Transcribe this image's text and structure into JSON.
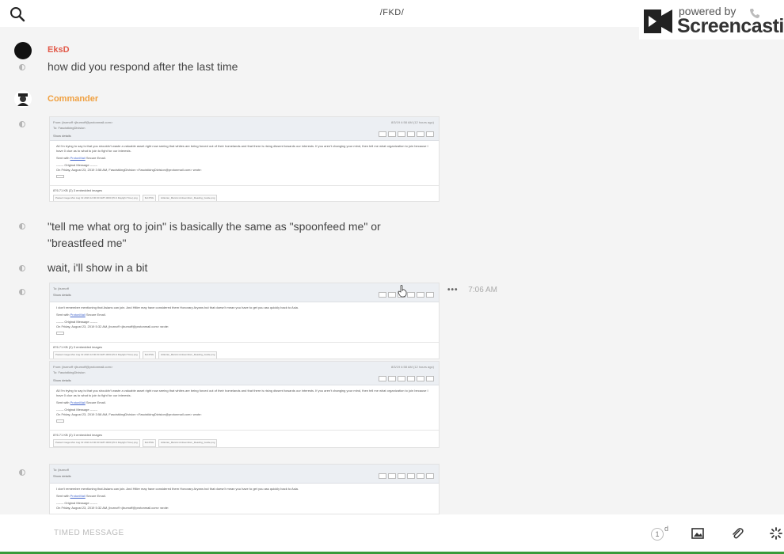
{
  "header": {
    "title": "/FKD/",
    "search_icon": "search-icon",
    "phone_icon": "phone-icon"
  },
  "watermark": {
    "powered": "powered by",
    "brand": "Screencastify"
  },
  "messages": {
    "m1": {
      "user": "EksD",
      "text": "how did you respond after the last time"
    },
    "m2": {
      "user": "Commander"
    },
    "m3": {
      "text": "\"tell me what org to join\" is basically the same as \"spoonfeed me\" or \"breastfeed me\""
    },
    "m4": {
      "text": "wait, i'll show in a bit"
    },
    "m5": {
      "time": "7:06 AM",
      "more": "•••"
    }
  },
  "email": {
    "from_a": "From: jburnoff <jburnoff@protonmail.com>",
    "to_a": "To: FascistkingDivision",
    "show_details": "Show details",
    "meta": "8/3/19 4:58 AM (12 hours ago)",
    "body_a": "All I'm trying to say is that you shouldn't waste a valuable asset right now seeing that whites are being forced out of their homelands and that there is rising dissent towards our interests. If you aren't changing your mind, then tell me what organization to join because I have 0 clue as to what to join to fight for our interests.",
    "sent_with": "Sent with",
    "protonmail": "ProtonMail",
    "secure_email": "Secure Email.",
    "original": "------- Original Message -------",
    "on_a": "On Friday, August 23, 2019 3:58 AM, FascistkingDivision <FascistkingDivision@protonmail.com> wrote:",
    "to_b": "To: jburnoff",
    "body_b": "I don't remember mentioning that Asians can join. And Hitler may have considered them Honorary Aryans but that doesn't mean you have to get you ass quickly back to Asia.",
    "on_b": "On Friday, August 23, 2019 5:32 AM, jburnoff <jburnoff@protonmail.com> wrote:",
    "embedded": "876.71 KB (2) 3 embedded images",
    "files": [
      "Pasted image-Mon Aug 19 2019 12:00:00 GMT-0000 (PLS Daylight Time).png",
      "fkd.PNG",
      "Hitlerian_Marxist Antisemitism_Reading_Guide.png"
    ]
  },
  "footer": {
    "composer_placeholder": "TIMED MESSAGE",
    "timer_value": "1",
    "timer_unit": "d"
  }
}
